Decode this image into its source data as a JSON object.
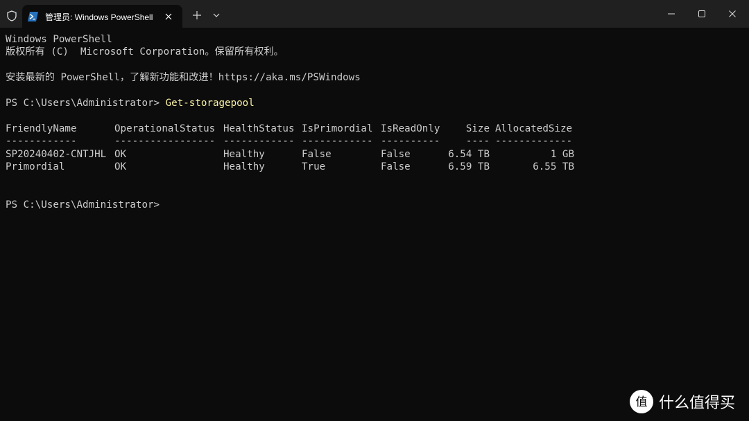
{
  "titlebar": {
    "tab_title": "管理员: Windows PowerShell",
    "icons": [
      "shield-icon",
      "powershell-icon",
      "close-icon",
      "plus-icon",
      "chevron-down-icon",
      "minimize-icon",
      "maximize-icon",
      "close-icon"
    ]
  },
  "terminal": {
    "banner_line1": "Windows PowerShell",
    "banner_line2": "版权所有 (C)  Microsoft Corporation。保留所有权利。",
    "banner_line3": "安装最新的 PowerShell，了解新功能和改进！https://aka.ms/PSWindows",
    "prompt1": "PS C:\\Users\\Administrator> ",
    "command1": "Get-storagepool",
    "table": {
      "headers": [
        "FriendlyName",
        "OperationalStatus",
        "HealthStatus",
        "IsPrimordial",
        "IsReadOnly",
        "Size",
        "AllocatedSize"
      ],
      "separators": [
        "------------",
        "-----------------",
        "------------",
        "------------",
        "----------",
        "----",
        "-------------"
      ],
      "rows": [
        [
          "SP20240402-CNTJHL",
          "OK",
          "Healthy",
          "False",
          "False",
          "6.54 TB",
          "1 GB"
        ],
        [
          "Primordial",
          "OK",
          "Healthy",
          "True",
          "False",
          "6.59 TB",
          "6.55 TB"
        ]
      ]
    },
    "prompt2": "PS C:\\Users\\Administrator>"
  },
  "watermark": {
    "logo_glyph": "值",
    "text": "什么值得买"
  },
  "colors": {
    "background": "#0c0c0c",
    "titlebar": "#202020",
    "text": "#cccccc",
    "command": "#f9f1a5"
  }
}
